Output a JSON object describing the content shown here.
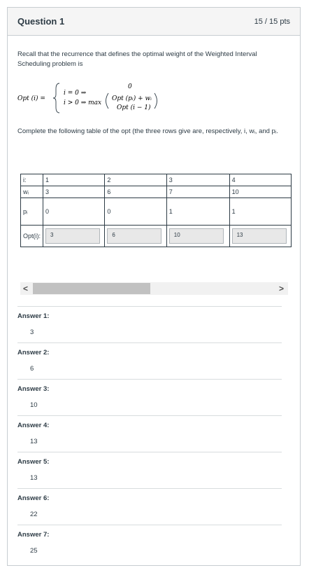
{
  "header": {
    "title": "Question 1",
    "points": "15 / 15 pts"
  },
  "prompt": {
    "intro": "Recall that the recurrence that defines the optimal weight of the Weighted Interval Scheduling problem is",
    "formula": {
      "lhs": "Opt (i) =",
      "case1": "i = 0 ⇒",
      "case2": "i > 0 ⇒ max",
      "zero": "0",
      "opt_pi": "Opt (pᵢ) + wᵢ",
      "opt_prev": "Opt (i − 1)"
    },
    "instruction": "Complete the following  table of the opt (the three rows give are, respectively, i, wᵢ, and pᵢ."
  },
  "table": {
    "rows": [
      {
        "label": "i:",
        "values": [
          "1",
          "2",
          "3",
          "4"
        ]
      },
      {
        "label": "wᵢ",
        "values": [
          "3",
          "6",
          "7",
          "10"
        ]
      },
      {
        "label": "pᵢ",
        "values": [
          "0",
          "0",
          "1",
          "1"
        ]
      }
    ],
    "opt_label": "Opt(i):",
    "opt_values": [
      "3",
      "6",
      "10",
      "13"
    ]
  },
  "scrollbar": {
    "left_arrow": "<",
    "right_arrow": ">"
  },
  "answers": [
    {
      "label": "Answer 1:",
      "value": "3"
    },
    {
      "label": "Answer 2:",
      "value": "6"
    },
    {
      "label": "Answer 3:",
      "value": "10"
    },
    {
      "label": "Answer 4:",
      "value": "13"
    },
    {
      "label": "Answer 5:",
      "value": "13"
    },
    {
      "label": "Answer 6:",
      "value": "22"
    },
    {
      "label": "Answer 7:",
      "value": "25"
    }
  ]
}
